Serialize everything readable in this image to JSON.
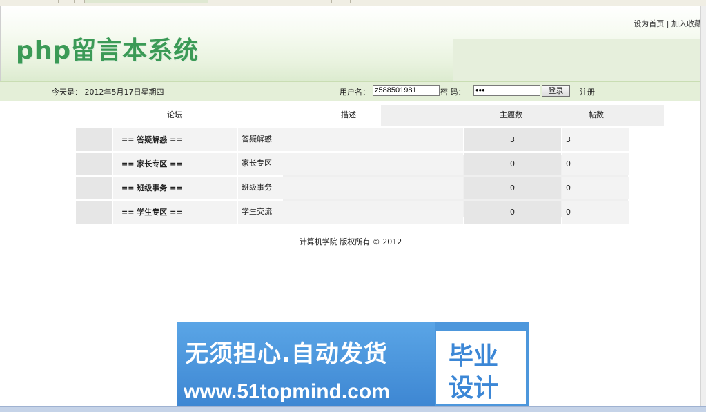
{
  "header": {
    "logo": "php留言本系统",
    "set_home": "设为首页",
    "separator": "|",
    "add_fav": "加入收藏"
  },
  "bar": {
    "date": "今天是：  2012年5月17日星期四",
    "username_label": "用户名：",
    "username_value": "z588501981",
    "password_label": "密  码：",
    "password_value": "•••",
    "login_button": "登录",
    "register_link": "注册"
  },
  "table": {
    "headers": [
      "论坛",
      "描述",
      "主题数",
      "帖数"
    ],
    "rows": [
      {
        "name": "== 答疑解惑 ==",
        "desc": "答疑解惑",
        "topics": "3",
        "posts": "3"
      },
      {
        "name": "== 家长专区 ==",
        "desc": "家长专区",
        "topics": "0",
        "posts": "0"
      },
      {
        "name": "== 班级事务 ==",
        "desc": "班级事务",
        "topics": "0",
        "posts": "0"
      },
      {
        "name": "== 学生专区 ==",
        "desc": "学生交流",
        "topics": "0",
        "posts": "0"
      }
    ]
  },
  "footer": "计算机学院 版权所有 © 2012",
  "banner": {
    "line1": "无须担心.自动发货",
    "line2": "www.51topmind.com",
    "right_line1": "毕业",
    "right_line2": "设计"
  }
}
